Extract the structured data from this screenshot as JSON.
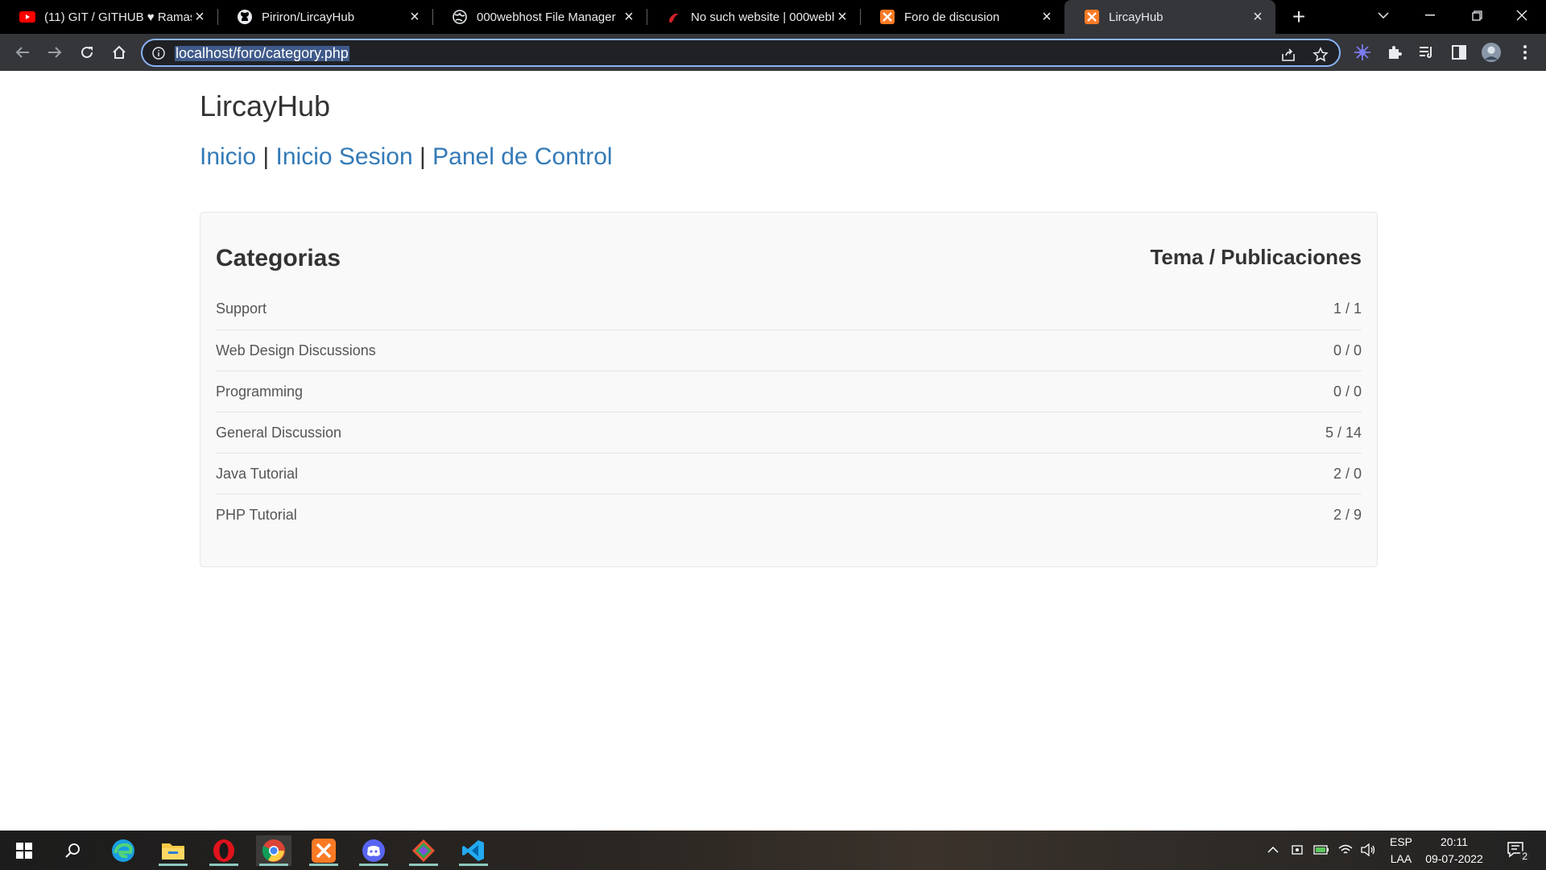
{
  "browser": {
    "tabs": [
      {
        "title": "(11) GIT / GITHUB ♥ Ramas",
        "icon": "youtube-icon"
      },
      {
        "title": "Piriron/LircayHub",
        "icon": "github-icon"
      },
      {
        "title": "000webhost File Manager",
        "icon": "globe-icon"
      },
      {
        "title": "No such website | 000webh",
        "icon": "000webhost-icon"
      },
      {
        "title": "Foro de discusion",
        "icon": "xampp-icon"
      },
      {
        "title": "LircayHub",
        "icon": "xampp-icon",
        "active": true
      }
    ],
    "url": "localhost/foro/category.php"
  },
  "page": {
    "site_title": "LircayHub",
    "nav": {
      "home": "Inicio",
      "separator": "|",
      "login": "Inicio Sesion",
      "control_panel": "Panel de Control"
    },
    "table": {
      "heading_categories": "Categorias",
      "heading_stats": "Tema / Publicaciones",
      "rows": [
        {
          "name": "Support",
          "count": "1 / 1"
        },
        {
          "name": "Web Design Discussions",
          "count": "0 / 0"
        },
        {
          "name": "Programming",
          "count": "0 / 0"
        },
        {
          "name": "General Discussion",
          "count": "5 / 14"
        },
        {
          "name": "Java Tutorial",
          "count": "2 / 0"
        },
        {
          "name": "PHP Tutorial",
          "count": "2 / 9"
        }
      ]
    }
  },
  "taskbar": {
    "language": "ESP",
    "keyboard": "LAA",
    "time": "20:11",
    "date": "09-07-2022",
    "notification_count": "2"
  },
  "colors": {
    "link": "#337ab7",
    "panel_bg": "#f9f9f9",
    "browser_tabbar": "#000000",
    "browser_toolbar": "#35363a",
    "omnibox_border": "#8ab4f8"
  }
}
